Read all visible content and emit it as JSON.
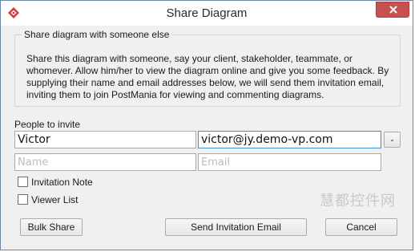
{
  "window": {
    "title": "Share Diagram",
    "close_icon": "close-icon",
    "app_icon": "visual-paradigm-logo-icon"
  },
  "share_section": {
    "title": "Share diagram with someone else",
    "description": "Share this diagram with someone, say your client, stakeholder, teammate, or whomever. Allow him/her to view the diagram online and give you some feedback. By supplying their name and email addresses below, we will send them invitation email, inviting them to join PostMania for viewing and commenting diagrams."
  },
  "invite": {
    "label": "People to invite",
    "rows": [
      {
        "name_value": "Victor",
        "email_value": "victor@jy.demo-vp.com",
        "remove_label": "-"
      },
      {
        "name_placeholder": "Name",
        "email_placeholder": "Email"
      }
    ]
  },
  "options": {
    "invitation_note": {
      "label": "Invitation Note",
      "checked": false
    },
    "viewer_list": {
      "label": "Viewer List",
      "checked": false
    }
  },
  "buttons": {
    "bulk_share": "Bulk Share",
    "send_invitation": "Send Invitation Email",
    "cancel": "Cancel"
  },
  "watermark": "慧都控件网",
  "colors": {
    "close_button": "#c75050",
    "focus_border": "#3f8fd6",
    "app_icon": "#d9383a"
  }
}
